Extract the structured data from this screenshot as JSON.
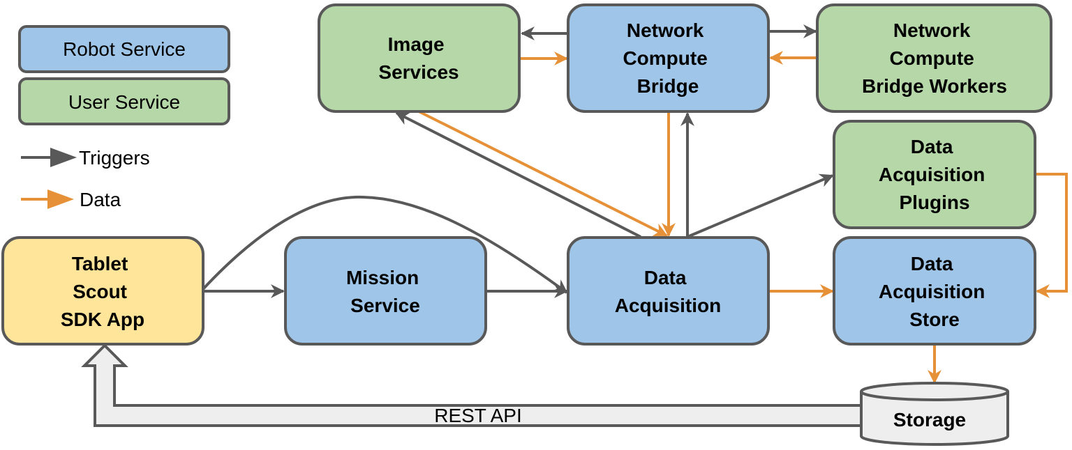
{
  "colors": {
    "robot_service": "#9fc5e8",
    "user_service": "#b6d7a8",
    "app": "#ffe599",
    "storage": "#eeeeee",
    "border": "#595959",
    "trigger": "#595959",
    "data": "#e69138"
  },
  "legend": {
    "robot_service": "Robot Service",
    "user_service": "User Service",
    "triggers": "Triggers",
    "data": "Data"
  },
  "nodes": {
    "image_services": [
      "Image",
      "Services"
    ],
    "network_compute_bridge": [
      "Network",
      "Compute",
      "Bridge"
    ],
    "ncb_workers": [
      "Network",
      "Compute",
      "Bridge Workers"
    ],
    "data_acquisition_plugins": [
      "Data",
      "Acquisition",
      "Plugins"
    ],
    "tablet_app": [
      "Tablet",
      "Scout",
      "SDK App"
    ],
    "mission_service": [
      "Mission",
      "Service"
    ],
    "data_acquisition": [
      "Data",
      "Acquisition"
    ],
    "data_acquisition_store": [
      "Data",
      "Acquisition",
      "Store"
    ],
    "storage": "Storage"
  },
  "edges": {
    "rest_api_label": "REST API"
  }
}
